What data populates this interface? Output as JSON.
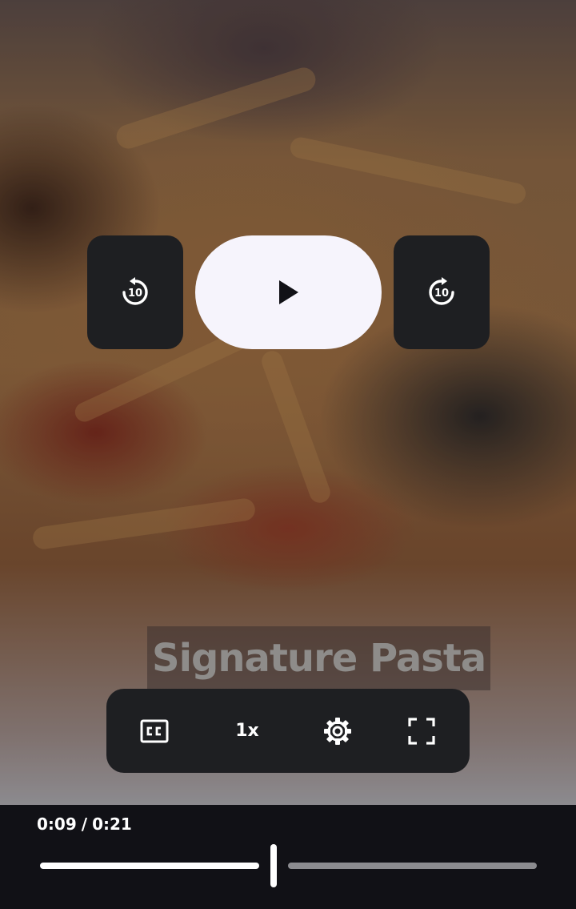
{
  "video": {
    "caption": "Signature Pasta"
  },
  "transport": {
    "skip_back_icon": "replay-10-icon",
    "skip_back_label": "10",
    "play_icon": "play-icon",
    "skip_forward_icon": "forward-10-icon",
    "skip_forward_label": "10"
  },
  "controls": {
    "captions_icon": "closed-captions-icon",
    "speed_label": "1x",
    "settings_icon": "gear-icon",
    "fullscreen_icon": "fullscreen-icon"
  },
  "progress": {
    "current_time": "0:09",
    "separator": "/",
    "duration": "0:21",
    "played_fraction": 0.46
  },
  "colors": {
    "control_bg": "#1e1f22",
    "play_bg": "#f6f4fc",
    "bar_bg": "#111116",
    "played": "#ffffff",
    "remaining": "#8c8c90"
  }
}
